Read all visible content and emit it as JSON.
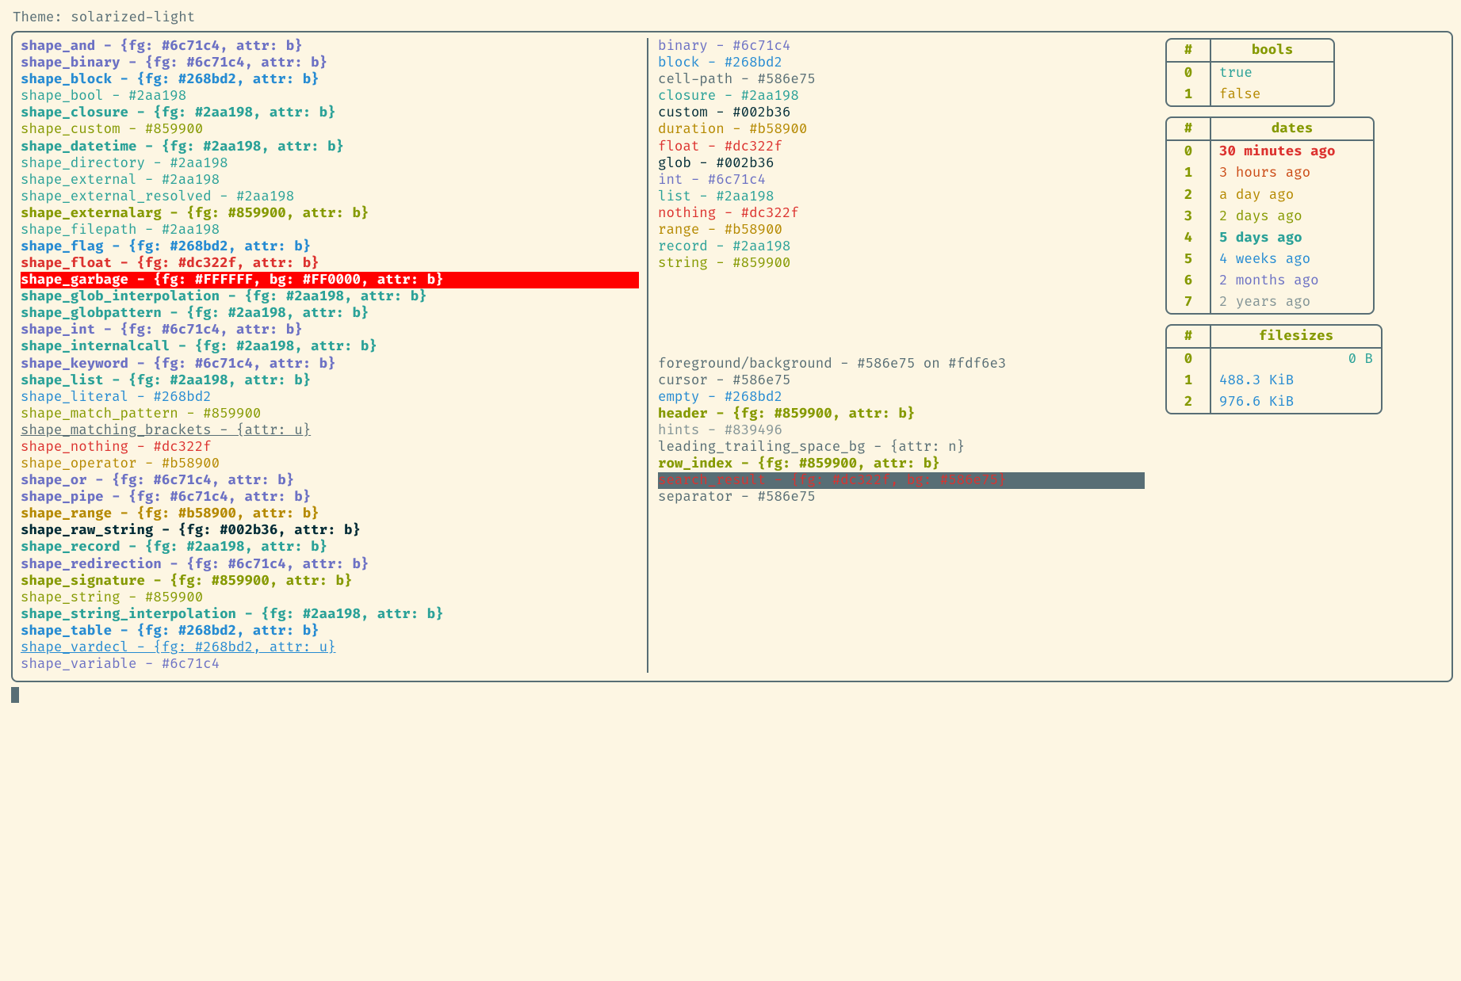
{
  "header": {
    "theme_label": "Theme: ",
    "theme_name": "solarized-light"
  },
  "colors": {
    "bg": "#fdf6e3",
    "fg": "#586e75",
    "base03": "#002b36",
    "yellow": "#b58900",
    "orange": "#cb4b16",
    "red": "#dc322f",
    "magenta": "#d33682",
    "violet": "#6c71c4",
    "blue": "#268bd2",
    "cyan": "#2aa198",
    "green": "#859900",
    "grey": "#839496"
  },
  "shapes": [
    {
      "name": "shape_and",
      "sep": " - ",
      "def": "{fg: #6c71c4, attr: b}",
      "fg": "#6c71c4",
      "bg": null,
      "bold": true,
      "underline": false
    },
    {
      "name": "shape_binary",
      "sep": " - ",
      "def": "{fg: #6c71c4, attr: b}",
      "fg": "#6c71c4",
      "bg": null,
      "bold": true,
      "underline": false
    },
    {
      "name": "shape_block",
      "sep": " - ",
      "def": "{fg: #268bd2, attr: b}",
      "fg": "#268bd2",
      "bg": null,
      "bold": true,
      "underline": false
    },
    {
      "name": "shape_bool",
      "sep": " - ",
      "def": "#2aa198",
      "fg": "#2aa198",
      "bg": null,
      "bold": false,
      "underline": false
    },
    {
      "name": "shape_closure",
      "sep": " - ",
      "def": "{fg: #2aa198, attr: b}",
      "fg": "#2aa198",
      "bg": null,
      "bold": true,
      "underline": false
    },
    {
      "name": "shape_custom",
      "sep": " - ",
      "def": "#859900",
      "fg": "#859900",
      "bg": null,
      "bold": false,
      "underline": false
    },
    {
      "name": "shape_datetime",
      "sep": " - ",
      "def": "{fg: #2aa198, attr: b}",
      "fg": "#2aa198",
      "bg": null,
      "bold": true,
      "underline": false
    },
    {
      "name": "shape_directory",
      "sep": " - ",
      "def": "#2aa198",
      "fg": "#2aa198",
      "bg": null,
      "bold": false,
      "underline": false
    },
    {
      "name": "shape_external",
      "sep": " - ",
      "def": "#2aa198",
      "fg": "#2aa198",
      "bg": null,
      "bold": false,
      "underline": false
    },
    {
      "name": "shape_external_resolved",
      "sep": " - ",
      "def": "#2aa198",
      "fg": "#2aa198",
      "bg": null,
      "bold": false,
      "underline": false
    },
    {
      "name": "shape_externalarg",
      "sep": " - ",
      "def": "{fg: #859900, attr: b}",
      "fg": "#859900",
      "bg": null,
      "bold": true,
      "underline": false
    },
    {
      "name": "shape_filepath",
      "sep": " - ",
      "def": "#2aa198",
      "fg": "#2aa198",
      "bg": null,
      "bold": false,
      "underline": false
    },
    {
      "name": "shape_flag",
      "sep": " - ",
      "def": "{fg: #268bd2, attr: b}",
      "fg": "#268bd2",
      "bg": null,
      "bold": true,
      "underline": false
    },
    {
      "name": "shape_float",
      "sep": " - ",
      "def": "{fg: #dc322f, attr: b}",
      "fg": "#dc322f",
      "bg": null,
      "bold": true,
      "underline": false
    },
    {
      "name": "shape_garbage",
      "sep": " - ",
      "def": "{fg: #FFFFFF, bg: #FF0000, attr: b}",
      "fg": "#FFFFFF",
      "bg": "#FF0000",
      "bold": true,
      "underline": false
    },
    {
      "name": "shape_glob_interpolation",
      "sep": " - ",
      "def": "{fg: #2aa198, attr: b}",
      "fg": "#2aa198",
      "bg": null,
      "bold": true,
      "underline": false
    },
    {
      "name": "shape_globpattern",
      "sep": " - ",
      "def": "{fg: #2aa198, attr: b}",
      "fg": "#2aa198",
      "bg": null,
      "bold": true,
      "underline": false
    },
    {
      "name": "shape_int",
      "sep": " - ",
      "def": "{fg: #6c71c4, attr: b}",
      "fg": "#6c71c4",
      "bg": null,
      "bold": true,
      "underline": false
    },
    {
      "name": "shape_internalcall",
      "sep": " - ",
      "def": "{fg: #2aa198, attr: b}",
      "fg": "#2aa198",
      "bg": null,
      "bold": true,
      "underline": false
    },
    {
      "name": "shape_keyword",
      "sep": " - ",
      "def": "{fg: #6c71c4, attr: b}",
      "fg": "#6c71c4",
      "bg": null,
      "bold": true,
      "underline": false
    },
    {
      "name": "shape_list",
      "sep": " - ",
      "def": "{fg: #2aa198, attr: b}",
      "fg": "#2aa198",
      "bg": null,
      "bold": true,
      "underline": false
    },
    {
      "name": "shape_literal",
      "sep": " - ",
      "def": "#268bd2",
      "fg": "#268bd2",
      "bg": null,
      "bold": false,
      "underline": false
    },
    {
      "name": "shape_match_pattern",
      "sep": " - ",
      "def": "#859900",
      "fg": "#859900",
      "bg": null,
      "bold": false,
      "underline": false
    },
    {
      "name": "shape_matching_brackets",
      "sep": " - ",
      "def": "{attr: u}",
      "fg": "#586e75",
      "bg": null,
      "bold": false,
      "underline": true
    },
    {
      "name": "shape_nothing",
      "sep": " - ",
      "def": "#dc322f",
      "fg": "#dc322f",
      "bg": null,
      "bold": false,
      "underline": false
    },
    {
      "name": "shape_operator",
      "sep": " - ",
      "def": "#b58900",
      "fg": "#b58900",
      "bg": null,
      "bold": false,
      "underline": false
    },
    {
      "name": "shape_or",
      "sep": " - ",
      "def": "{fg: #6c71c4, attr: b}",
      "fg": "#6c71c4",
      "bg": null,
      "bold": true,
      "underline": false
    },
    {
      "name": "shape_pipe",
      "sep": " - ",
      "def": "{fg: #6c71c4, attr: b}",
      "fg": "#6c71c4",
      "bg": null,
      "bold": true,
      "underline": false
    },
    {
      "name": "shape_range",
      "sep": " - ",
      "def": "{fg: #b58900, attr: b}",
      "fg": "#b58900",
      "bg": null,
      "bold": true,
      "underline": false
    },
    {
      "name": "shape_raw_string",
      "sep": " - ",
      "def": "{fg: #002b36, attr: b}",
      "fg": "#002b36",
      "bg": null,
      "bold": true,
      "underline": false
    },
    {
      "name": "shape_record",
      "sep": " - ",
      "def": "{fg: #2aa198, attr: b}",
      "fg": "#2aa198",
      "bg": null,
      "bold": true,
      "underline": false
    },
    {
      "name": "shape_redirection",
      "sep": " - ",
      "def": "{fg: #6c71c4, attr: b}",
      "fg": "#6c71c4",
      "bg": null,
      "bold": true,
      "underline": false
    },
    {
      "name": "shape_signature",
      "sep": " - ",
      "def": "{fg: #859900, attr: b}",
      "fg": "#859900",
      "bg": null,
      "bold": true,
      "underline": false
    },
    {
      "name": "shape_string",
      "sep": " - ",
      "def": "#859900",
      "fg": "#859900",
      "bg": null,
      "bold": false,
      "underline": false
    },
    {
      "name": "shape_string_interpolation",
      "sep": " - ",
      "def": "{fg: #2aa198, attr: b}",
      "fg": "#2aa198",
      "bg": null,
      "bold": true,
      "underline": false
    },
    {
      "name": "shape_table",
      "sep": " - ",
      "def": "{fg: #268bd2, attr: b}",
      "fg": "#268bd2",
      "bg": null,
      "bold": true,
      "underline": false
    },
    {
      "name": "shape_vardecl",
      "sep": " - ",
      "def": "{fg: #268bd2, attr: u}",
      "fg": "#268bd2",
      "bg": null,
      "bold": false,
      "underline": true
    },
    {
      "name": "shape_variable",
      "sep": " - ",
      "def": "#6c71c4",
      "fg": "#6c71c4",
      "bg": null,
      "bold": false,
      "underline": false
    }
  ],
  "types": [
    {
      "name": "binary",
      "sep": " - ",
      "def": "#6c71c4",
      "fg": "#6c71c4",
      "bg": null,
      "bold": false
    },
    {
      "name": "block",
      "sep": " - ",
      "def": "#268bd2",
      "fg": "#268bd2",
      "bg": null,
      "bold": false
    },
    {
      "name": "cell-path",
      "sep": " - ",
      "def": "#586e75",
      "fg": "#586e75",
      "bg": null,
      "bold": false
    },
    {
      "name": "closure",
      "sep": " - ",
      "def": "#2aa198",
      "fg": "#2aa198",
      "bg": null,
      "bold": false
    },
    {
      "name": "custom",
      "sep": " - ",
      "def": "#002b36",
      "fg": "#002b36",
      "bg": null,
      "bold": false
    },
    {
      "name": "duration",
      "sep": " - ",
      "def": "#b58900",
      "fg": "#b58900",
      "bg": null,
      "bold": false
    },
    {
      "name": "float",
      "sep": " - ",
      "def": "#dc322f",
      "fg": "#dc322f",
      "bg": null,
      "bold": false
    },
    {
      "name": "glob",
      "sep": " - ",
      "def": "#002b36",
      "fg": "#002b36",
      "bg": null,
      "bold": false
    },
    {
      "name": "int",
      "sep": " - ",
      "def": "#6c71c4",
      "fg": "#6c71c4",
      "bg": null,
      "bold": false
    },
    {
      "name": "list",
      "sep": " - ",
      "def": "#2aa198",
      "fg": "#2aa198",
      "bg": null,
      "bold": false
    },
    {
      "name": "nothing",
      "sep": " - ",
      "def": "#dc322f",
      "fg": "#dc322f",
      "bg": null,
      "bold": false
    },
    {
      "name": "range",
      "sep": " - ",
      "def": "#b58900",
      "fg": "#b58900",
      "bg": null,
      "bold": false
    },
    {
      "name": "record",
      "sep": " - ",
      "def": "#2aa198",
      "fg": "#2aa198",
      "bg": null,
      "bold": false
    },
    {
      "name": "string",
      "sep": " - ",
      "def": "#859900",
      "fg": "#859900",
      "bg": null,
      "bold": false
    }
  ],
  "misc": [
    {
      "name": "foreground/background",
      "sep": " - ",
      "def": "#586e75 on #fdf6e3",
      "fg": "#586e75",
      "bg": null,
      "bold": false
    },
    {
      "name": "cursor",
      "sep": " - ",
      "def": "#586e75",
      "fg": "#586e75",
      "bg": null,
      "bold": false
    },
    {
      "name": "empty",
      "sep": " - ",
      "def": "#268bd2",
      "fg": "#268bd2",
      "bg": null,
      "bold": false
    },
    {
      "name": "header",
      "sep": " - ",
      "def": "{fg: #859900, attr: b}",
      "fg": "#859900",
      "bg": null,
      "bold": true
    },
    {
      "name": "hints",
      "sep": " - ",
      "def": "#839496",
      "fg": "#839496",
      "bg": null,
      "bold": false
    },
    {
      "name": "leading_trailing_space_bg",
      "sep": " - ",
      "def": "{attr: n}",
      "fg": "#586e75",
      "bg": null,
      "bold": false
    },
    {
      "name": "row_index",
      "sep": " - ",
      "def": "{fg: #859900, attr: b}",
      "fg": "#859900",
      "bg": null,
      "bold": true
    },
    {
      "name": "search_result",
      "sep": " - ",
      "def": "{fg: #dc322f, bg: #586e75}",
      "fg": "#dc322f",
      "bg": "#586e75",
      "bold": false
    },
    {
      "name": "separator",
      "sep": " - ",
      "def": "#586e75",
      "fg": "#586e75",
      "bg": null,
      "bold": false
    }
  ],
  "tables": {
    "bools": {
      "idx_header": "#",
      "val_header": "bools",
      "rows": [
        {
          "idx": "0",
          "val": "true",
          "fg": "#2aa198",
          "bold": false
        },
        {
          "idx": "1",
          "val": "false",
          "fg": "#b58900",
          "bold": false
        }
      ]
    },
    "dates": {
      "idx_header": "#",
      "val_header": "dates",
      "rows": [
        {
          "idx": "0",
          "val": "30 minutes ago",
          "fg": "#dc322f",
          "bold": true
        },
        {
          "idx": "1",
          "val": "3 hours ago",
          "fg": "#cb4b16",
          "bold": false
        },
        {
          "idx": "2",
          "val": "a day ago",
          "fg": "#b58900",
          "bold": false
        },
        {
          "idx": "3",
          "val": "2 days ago",
          "fg": "#859900",
          "bold": false
        },
        {
          "idx": "4",
          "val": "5 days ago",
          "fg": "#2aa198",
          "bold": true
        },
        {
          "idx": "5",
          "val": "4 weeks ago",
          "fg": "#268bd2",
          "bold": false
        },
        {
          "idx": "6",
          "val": "2 months ago",
          "fg": "#6c71c4",
          "bold": false
        },
        {
          "idx": "7",
          "val": "2 years ago",
          "fg": "#839496",
          "bold": false
        }
      ]
    },
    "filesizes": {
      "idx_header": "#",
      "val_header": "filesizes",
      "rows": [
        {
          "idx": "0",
          "val": "0 B",
          "fg": "#2aa198",
          "bold": false,
          "align": "right"
        },
        {
          "idx": "1",
          "val": "488.3 KiB",
          "fg": "#268bd2",
          "bold": false,
          "align": "left"
        },
        {
          "idx": "2",
          "val": "976.6 KiB",
          "fg": "#268bd2",
          "bold": false,
          "align": "left"
        }
      ]
    }
  }
}
